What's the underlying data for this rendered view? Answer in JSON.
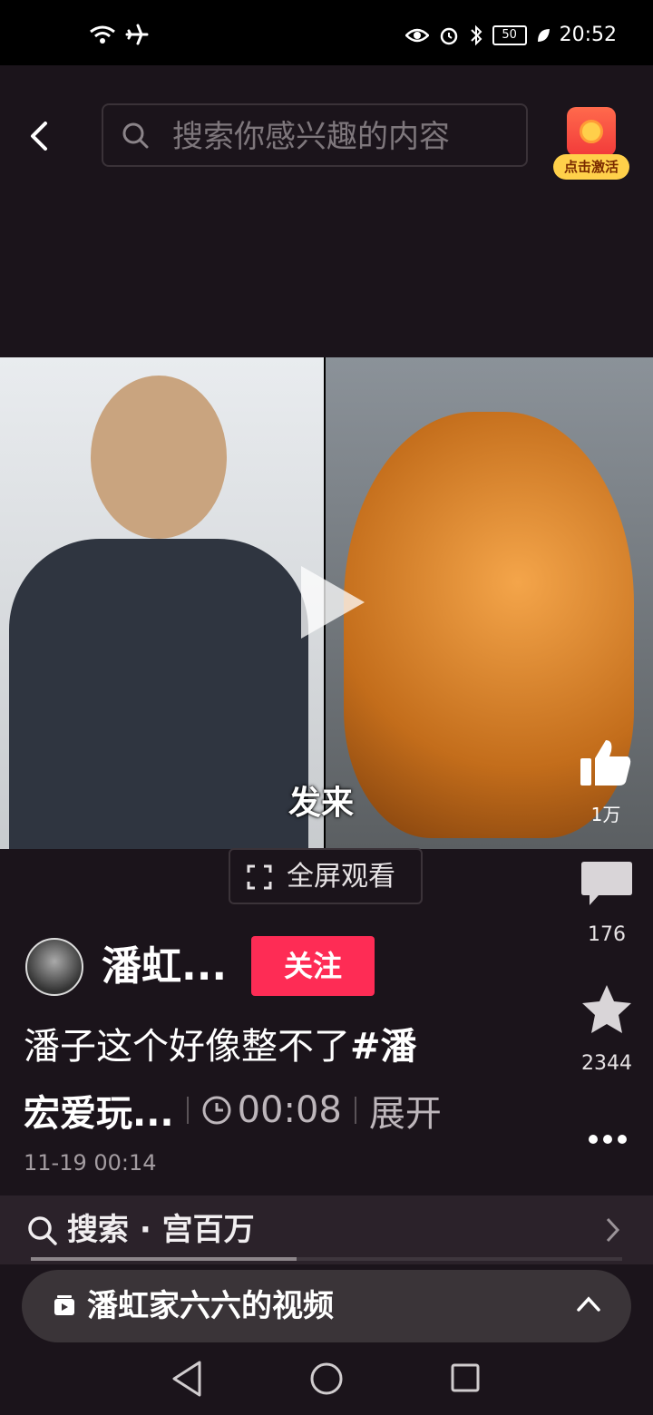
{
  "status_bar": {
    "time": "20:52",
    "battery": "50"
  },
  "search": {
    "placeholder": "搜索你感兴趣的内容"
  },
  "reward": {
    "label": "点击激活"
  },
  "video": {
    "subtitle": "发来",
    "likes": "1万"
  },
  "fullscreen": {
    "label": "全屏观看"
  },
  "rail": {
    "comments": "176",
    "favorites": "2344"
  },
  "author": {
    "name": "潘虹...",
    "follow_label": "关注"
  },
  "description": {
    "line1_text": "潘子这个好像整不了",
    "line1_tag": "#潘",
    "line2_text": "宏爱玩...",
    "duration": "00:08",
    "expand": "展开",
    "date": "11-19 00:14"
  },
  "related_search": {
    "label": "搜索 · 宫百万",
    "progress": 0.45
  },
  "collection": {
    "label": "潘虹家六六的视频"
  },
  "colors": {
    "accent": "#fe2c55",
    "background": "#1b141b",
    "reward_yellow": "#ffd04a"
  }
}
